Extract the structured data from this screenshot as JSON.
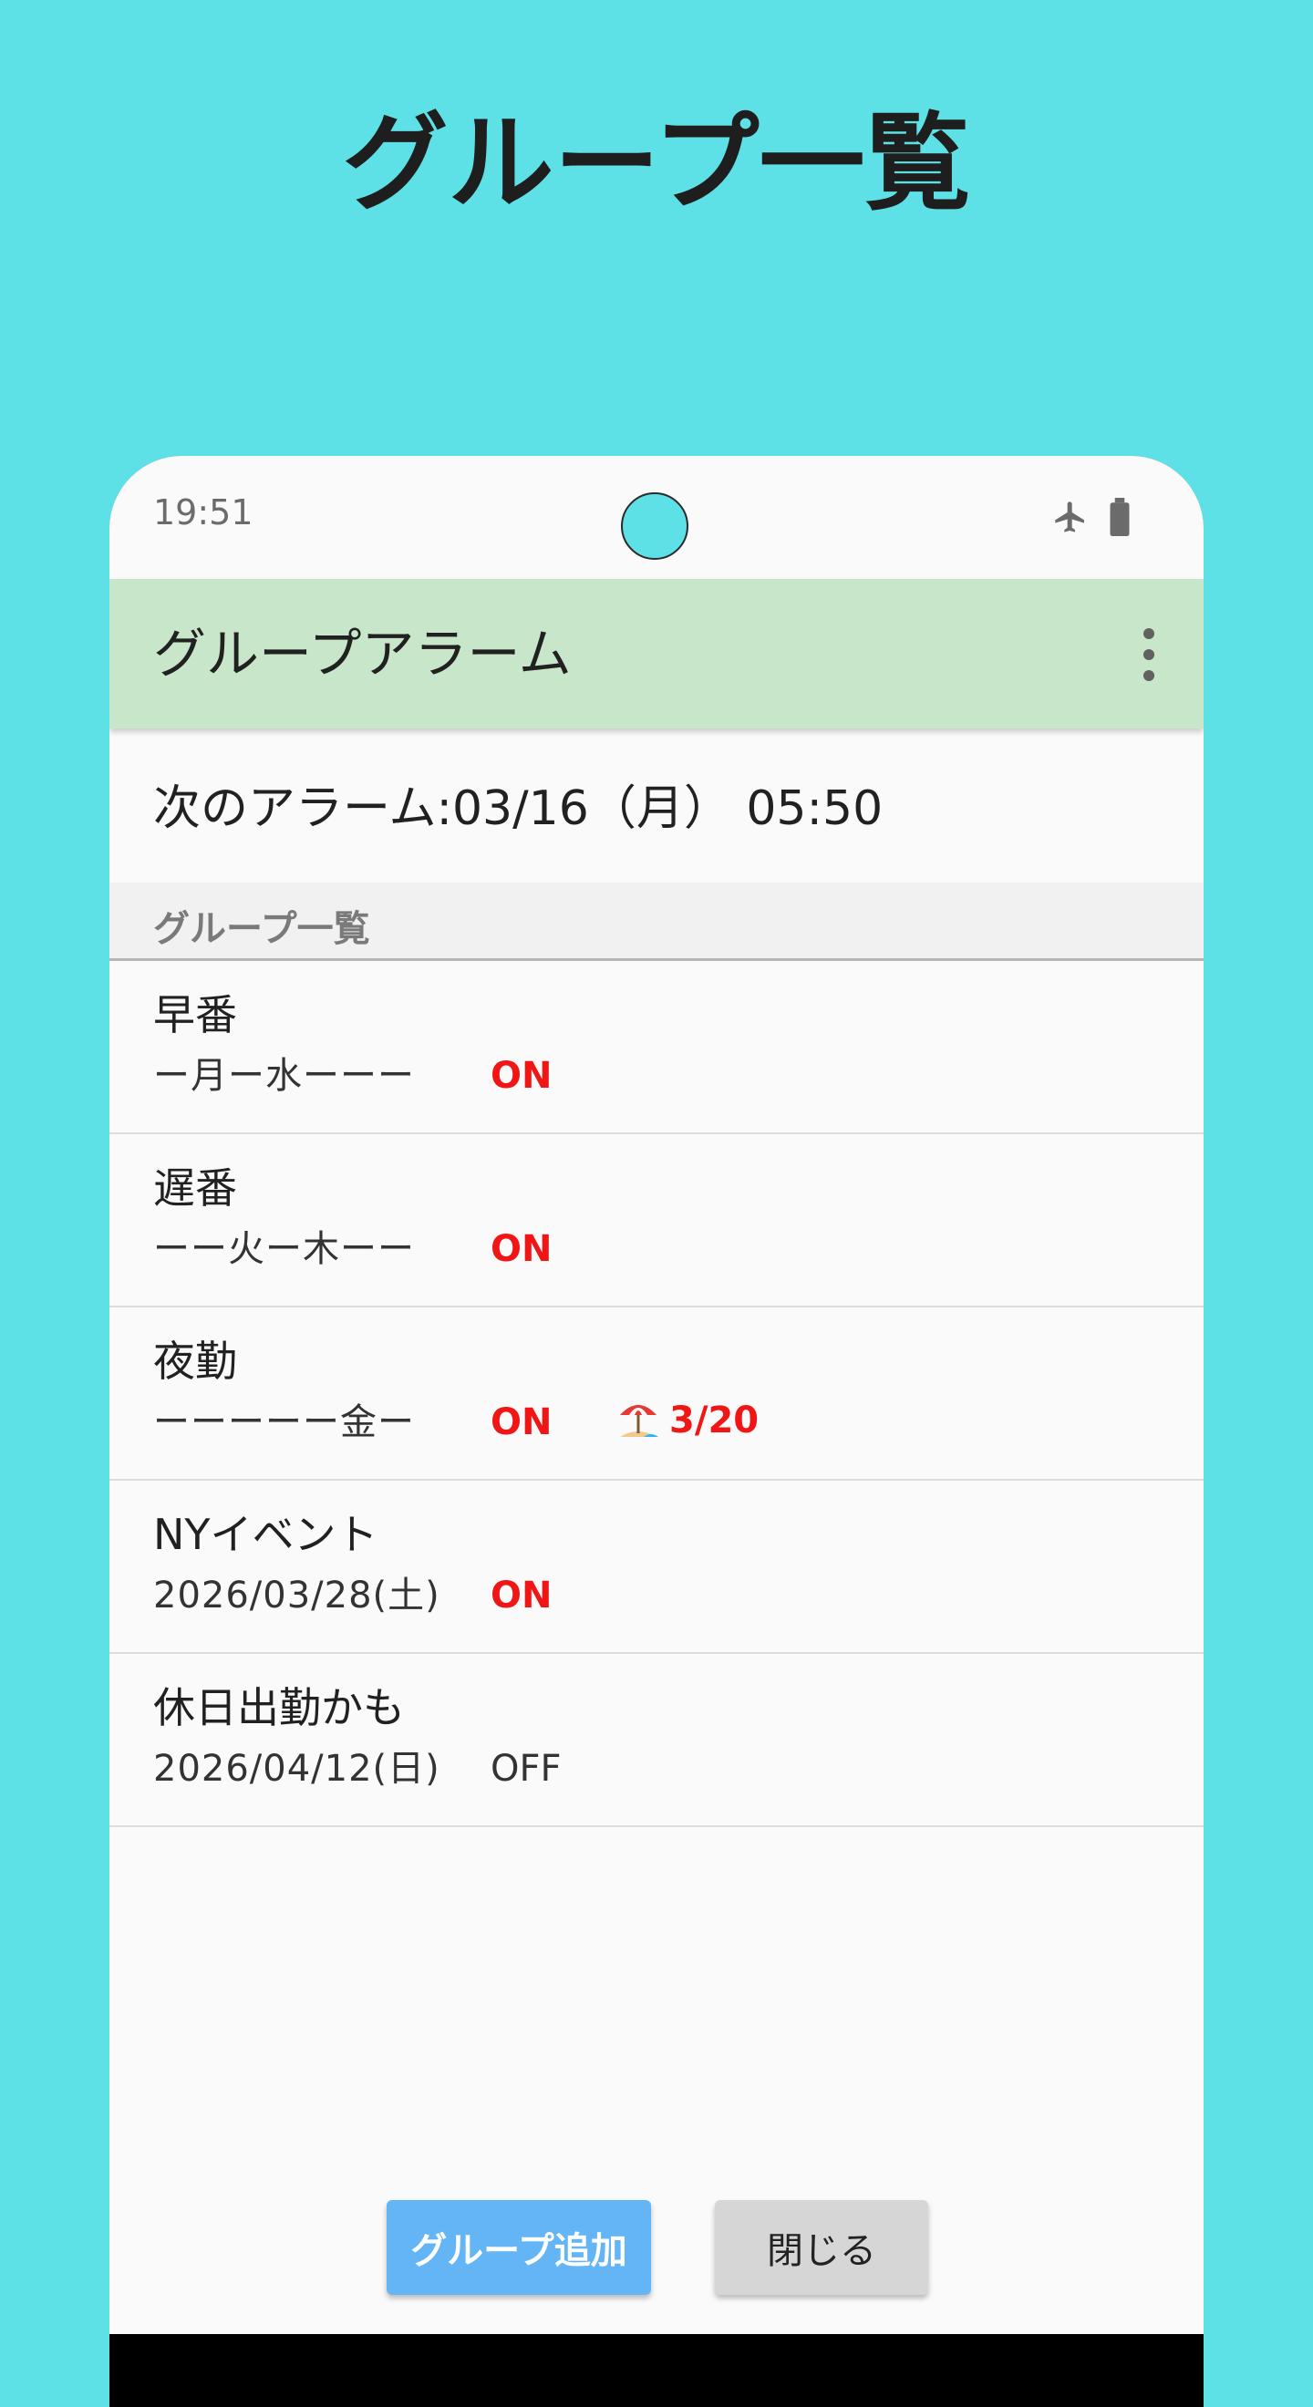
{
  "promo": {
    "title": "グループ一覧"
  },
  "status_bar": {
    "time": "19:51",
    "icons": [
      "airplane-icon",
      "battery-icon"
    ]
  },
  "app_bar": {
    "title": "グループアラーム",
    "menu_icon": "more-vert-icon"
  },
  "next_alarm": {
    "text": "次のアラーム:03/16（月） 05:50"
  },
  "section": {
    "label": "グループ一覧"
  },
  "groups": [
    {
      "name": "早番",
      "schedule": "ー月ー水ーーー",
      "status": "ON"
    },
    {
      "name": "遅番",
      "schedule": "ーー火ー木ーー",
      "status": "ON"
    },
    {
      "name": "夜勤",
      "schedule": "ーーーーー金ー",
      "status": "ON",
      "vacation_icon": "beach-umbrella-icon",
      "vacation_date": "3/20"
    },
    {
      "name": "NYイベント",
      "schedule": "2026/03/28(土)",
      "status": "ON"
    },
    {
      "name": "休日出勤かも",
      "schedule": "2026/04/12(日)",
      "status": "OFF"
    }
  ],
  "buttons": {
    "add_label": "グループ追加",
    "close_label": "閉じる"
  },
  "colors": {
    "background": "#5ee1e6",
    "app_bar": "#c8e6c9",
    "on_status": "#f01616",
    "add_button": "#64b5f6",
    "close_button": "#d6d6d6"
  }
}
